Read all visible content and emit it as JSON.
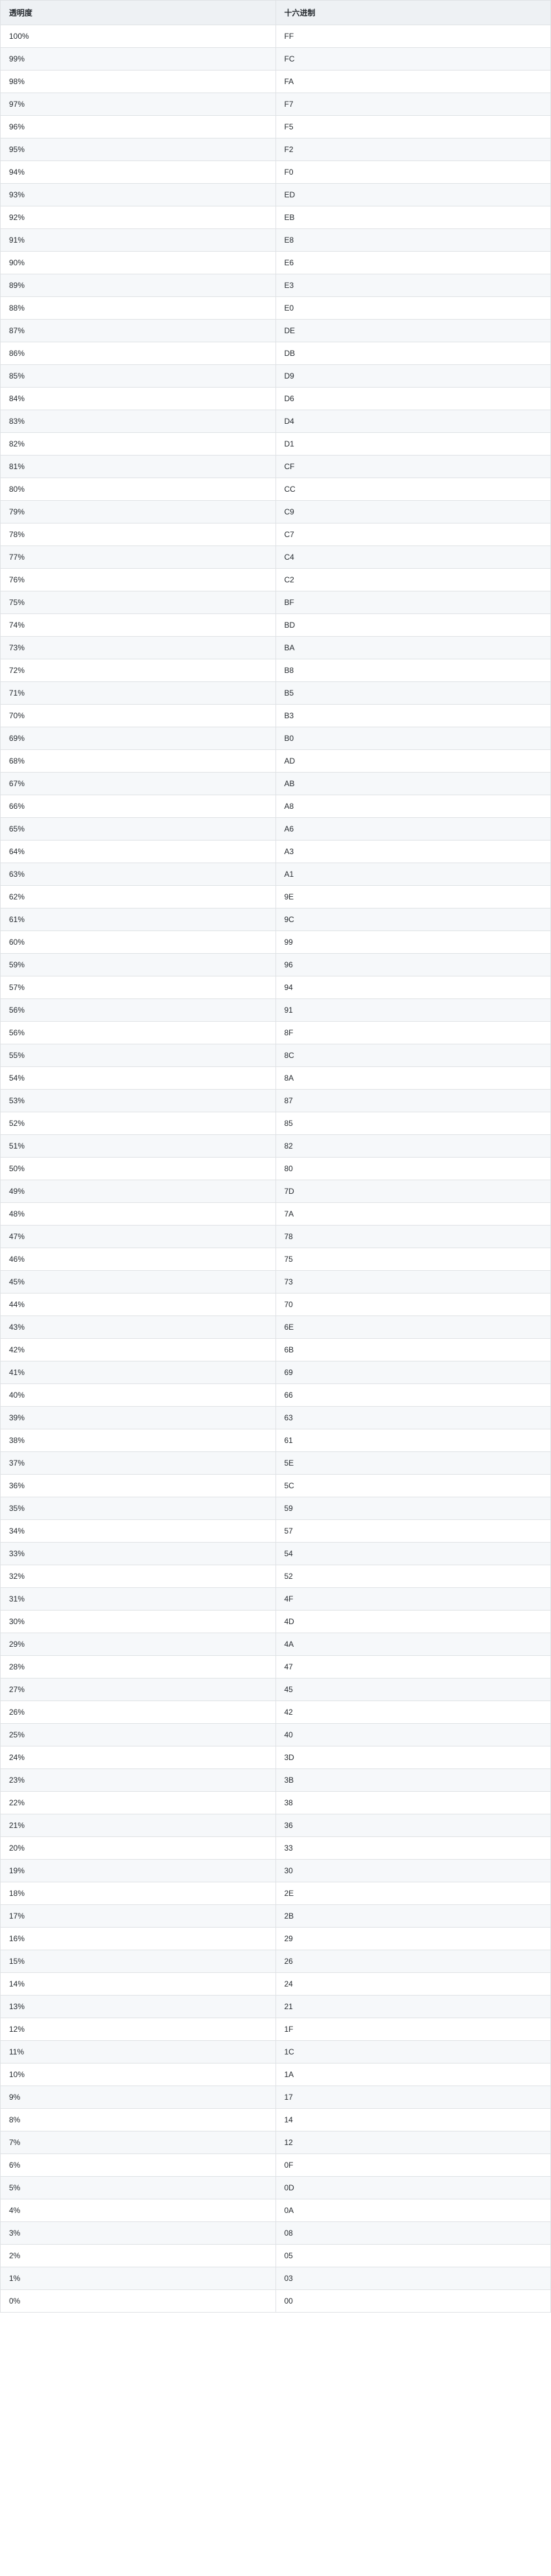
{
  "headers": {
    "col1": "透明度",
    "col2": "十六进制"
  },
  "rows": [
    {
      "p": "100%",
      "h": "FF"
    },
    {
      "p": "99%",
      "h": "FC"
    },
    {
      "p": "98%",
      "h": "FA"
    },
    {
      "p": "97%",
      "h": "F7"
    },
    {
      "p": "96%",
      "h": "F5"
    },
    {
      "p": "95%",
      "h": "F2"
    },
    {
      "p": "94%",
      "h": "F0"
    },
    {
      "p": "93%",
      "h": "ED"
    },
    {
      "p": "92%",
      "h": "EB"
    },
    {
      "p": "91%",
      "h": "E8"
    },
    {
      "p": "90%",
      "h": "E6"
    },
    {
      "p": "89%",
      "h": "E3"
    },
    {
      "p": "88%",
      "h": "E0"
    },
    {
      "p": "87%",
      "h": "DE"
    },
    {
      "p": "86%",
      "h": "DB"
    },
    {
      "p": "85%",
      "h": "D9"
    },
    {
      "p": "84%",
      "h": "D6"
    },
    {
      "p": "83%",
      "h": "D4"
    },
    {
      "p": "82%",
      "h": "D1"
    },
    {
      "p": "81%",
      "h": "CF"
    },
    {
      "p": "80%",
      "h": "CC"
    },
    {
      "p": "79%",
      "h": "C9"
    },
    {
      "p": "78%",
      "h": "C7"
    },
    {
      "p": "77%",
      "h": "C4"
    },
    {
      "p": "76%",
      "h": "C2"
    },
    {
      "p": "75%",
      "h": "BF"
    },
    {
      "p": "74%",
      "h": "BD"
    },
    {
      "p": "73%",
      "h": "BA"
    },
    {
      "p": "72%",
      "h": "B8"
    },
    {
      "p": "71%",
      "h": "B5"
    },
    {
      "p": "70%",
      "h": "B3"
    },
    {
      "p": "69%",
      "h": "B0"
    },
    {
      "p": "68%",
      "h": "AD"
    },
    {
      "p": "67%",
      "h": "AB"
    },
    {
      "p": "66%",
      "h": "A8"
    },
    {
      "p": "65%",
      "h": "A6"
    },
    {
      "p": "64%",
      "h": "A3"
    },
    {
      "p": "63%",
      "h": "A1"
    },
    {
      "p": "62%",
      "h": "9E"
    },
    {
      "p": "61%",
      "h": "9C"
    },
    {
      "p": "60%",
      "h": "99"
    },
    {
      "p": "59%",
      "h": "96"
    },
    {
      "p": "57%",
      "h": "94"
    },
    {
      "p": "56%",
      "h": "91"
    },
    {
      "p": "56%",
      "h": "8F"
    },
    {
      "p": "55%",
      "h": "8C"
    },
    {
      "p": "54%",
      "h": "8A"
    },
    {
      "p": "53%",
      "h": "87"
    },
    {
      "p": "52%",
      "h": "85"
    },
    {
      "p": "51%",
      "h": "82"
    },
    {
      "p": "50%",
      "h": "80"
    },
    {
      "p": "49%",
      "h": "7D"
    },
    {
      "p": "48%",
      "h": "7A"
    },
    {
      "p": "47%",
      "h": "78"
    },
    {
      "p": "46%",
      "h": "75"
    },
    {
      "p": "45%",
      "h": "73"
    },
    {
      "p": "44%",
      "h": "70"
    },
    {
      "p": "43%",
      "h": "6E"
    },
    {
      "p": "42%",
      "h": "6B"
    },
    {
      "p": "41%",
      "h": "69"
    },
    {
      "p": "40%",
      "h": "66"
    },
    {
      "p": "39%",
      "h": "63"
    },
    {
      "p": "38%",
      "h": "61"
    },
    {
      "p": "37%",
      "h": "5E"
    },
    {
      "p": "36%",
      "h": "5C"
    },
    {
      "p": "35%",
      "h": "59"
    },
    {
      "p": "34%",
      "h": "57"
    },
    {
      "p": "33%",
      "h": "54"
    },
    {
      "p": "32%",
      "h": "52"
    },
    {
      "p": "31%",
      "h": "4F"
    },
    {
      "p": "30%",
      "h": "4D"
    },
    {
      "p": "29%",
      "h": "4A"
    },
    {
      "p": "28%",
      "h": "47"
    },
    {
      "p": "27%",
      "h": "45"
    },
    {
      "p": "26%",
      "h": "42"
    },
    {
      "p": "25%",
      "h": "40"
    },
    {
      "p": "24%",
      "h": "3D"
    },
    {
      "p": "23%",
      "h": "3B"
    },
    {
      "p": "22%",
      "h": "38"
    },
    {
      "p": "21%",
      "h": "36"
    },
    {
      "p": "20%",
      "h": "33"
    },
    {
      "p": "19%",
      "h": "30"
    },
    {
      "p": "18%",
      "h": "2E"
    },
    {
      "p": "17%",
      "h": "2B"
    },
    {
      "p": "16%",
      "h": "29"
    },
    {
      "p": "15%",
      "h": "26"
    },
    {
      "p": "14%",
      "h": "24"
    },
    {
      "p": "13%",
      "h": "21"
    },
    {
      "p": "12%",
      "h": "1F"
    },
    {
      "p": "11%",
      "h": "1C"
    },
    {
      "p": "10%",
      "h": "1A"
    },
    {
      "p": "9%",
      "h": "17"
    },
    {
      "p": "8%",
      "h": "14"
    },
    {
      "p": "7%",
      "h": "12"
    },
    {
      "p": "6%",
      "h": "0F"
    },
    {
      "p": "5%",
      "h": "0D"
    },
    {
      "p": "4%",
      "h": "0A"
    },
    {
      "p": "3%",
      "h": "08"
    },
    {
      "p": "2%",
      "h": "05"
    },
    {
      "p": "1%",
      "h": "03"
    },
    {
      "p": "0%",
      "h": "00"
    }
  ]
}
